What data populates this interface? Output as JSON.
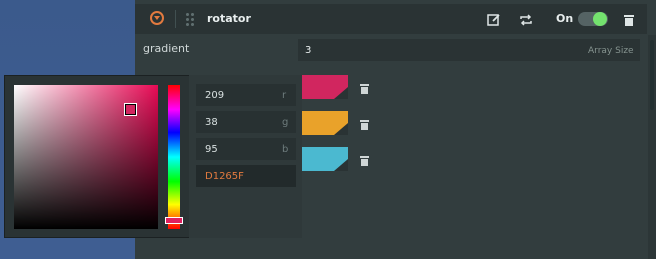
{
  "module": {
    "title": "rotator",
    "toggle_label": "On",
    "toggle_state": "on",
    "accent_color": "#e27a3f",
    "toggle_color": "#74e26e"
  },
  "property": {
    "label": "gradient",
    "array_value": "3",
    "array_suffix": "Array Size"
  },
  "gradient_swatches": [
    {
      "color": "#d1265f"
    },
    {
      "color": "#e9a22a"
    },
    {
      "color": "#4bb9d0"
    }
  ],
  "color_picker": {
    "r": "209",
    "g": "38",
    "b": "95",
    "r_label": "r",
    "g_label": "g",
    "b_label": "b",
    "hex": "D1265F"
  },
  "icons": {
    "collapse": "collapse-circle-chevron-icon",
    "drag": "drag-handle-icon",
    "edit": "edit-icon",
    "repeat": "repeat-icon",
    "trash": "trash-icon"
  }
}
